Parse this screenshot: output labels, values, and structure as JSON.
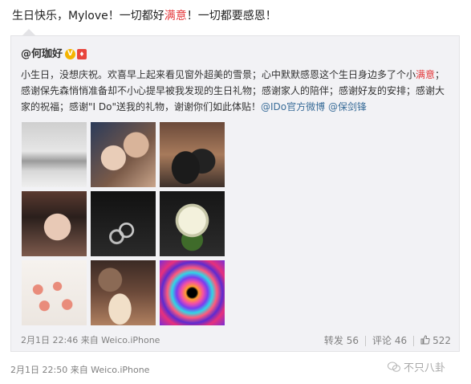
{
  "post": {
    "text_before": "生日快乐，Mylove！一切都好",
    "text_highlight": "满意",
    "text_after": "！一切都要感恩！"
  },
  "repost": {
    "author": "@何珈好",
    "body_part1": "小生日，没想庆祝。欢喜早上起来看见窗外超美的雪景；心中默默感恩这个生日身边多了个小",
    "body_highlight": "满意",
    "body_part2": "；感谢保先森悄悄准备却不小心提早被我发现的生日礼物；感谢家人的陪伴；感谢好友的安排；感谢大家的祝福；感谢\"I Do\"送我的礼物，谢谢你们如此体贴！",
    "mention_1": "@IDo官方微博",
    "mention_2": "@保剑锋",
    "images": [
      "snow-landscape",
      "couple-selfie",
      "family-photo",
      "woman-portrait",
      "rings",
      "flower-bouquet",
      "cake-slices",
      "birthday-cake",
      "colorful-spiral"
    ],
    "meta": "2月1日 22:46 来自 Weico.iPhone",
    "repost_label": "转发 56",
    "comment_label": "评论 46",
    "like_count": "522"
  },
  "outer_meta": "2月1日 22:50 来自 Weico.iPhone",
  "watermark": "不只八卦",
  "colors": {
    "highlight": "#e4393c",
    "link": "#3a6d99",
    "meta": "#808080"
  }
}
